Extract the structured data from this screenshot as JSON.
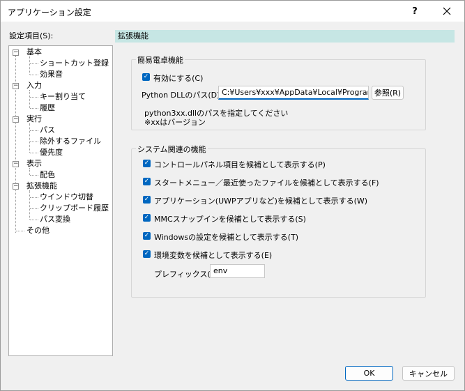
{
  "window": {
    "title": "アプリケーション設定",
    "help_label": "?",
    "close_label": "✕"
  },
  "tree": {
    "label": "設定項目(S):",
    "items": [
      {
        "label": "基本",
        "expander": "−"
      },
      {
        "label": "ショートカット登録"
      },
      {
        "label": "効果音"
      },
      {
        "label": "入力",
        "expander": "−"
      },
      {
        "label": "キー割り当て"
      },
      {
        "label": "履歴"
      },
      {
        "label": "実行",
        "expander": "−"
      },
      {
        "label": "パス"
      },
      {
        "label": "除外するファイル"
      },
      {
        "label": "優先度"
      },
      {
        "label": "表示",
        "expander": "−"
      },
      {
        "label": "配色"
      },
      {
        "label": "拡張機能",
        "expander": "−"
      },
      {
        "label": "ウインドウ切替"
      },
      {
        "label": "クリップボード履歴"
      },
      {
        "label": "パス変換"
      },
      {
        "label": "その他"
      }
    ]
  },
  "panel": {
    "header": "拡張機能",
    "calc_group": {
      "label": "簡易電卓機能",
      "enable_label": "有効にする(C)",
      "dll_label": "Python DLLのパス(D):",
      "dll_value": "C:¥Users¥xxx¥AppData¥Local¥Programs¥P",
      "browse_label": "参照(R)",
      "hint1": "python3xx.dllのパスを指定してください",
      "hint2": "※xxはバージョン"
    },
    "system_group": {
      "label": "システム関連の機能",
      "checks": [
        "コントロールパネル項目を候補として表示する(P)",
        "スタートメニュー／最近使ったファイルを候補として表示する(F)",
        "アプリケーション(UWPアプリなど)を候補として表示する(W)",
        "MMCスナップインを候補として表示する(S)",
        "Windowsの設定を候補として表示する(T)",
        "環境変数を候補として表示する(E)"
      ],
      "prefix_label": "プレフィックス(R):",
      "prefix_value": "env"
    }
  },
  "buttons": {
    "ok": "OK",
    "cancel": "キャンセル"
  },
  "colors": {
    "accent": "#0067c0",
    "header_bg": "#c6e6e4"
  }
}
